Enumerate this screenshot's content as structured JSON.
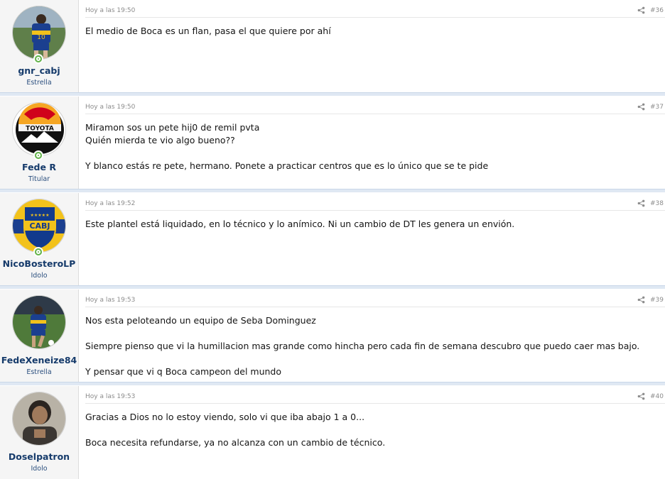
{
  "colors": {
    "username": "#163b6b",
    "usertitle": "#2b4f7e",
    "online": "#63b34a",
    "separator": "#dfe8f3"
  },
  "posts": [
    {
      "username": "gnr_cabj",
      "user_title": "Estrella",
      "avatar": "player-photo-avatar",
      "online": true,
      "date": "Hoy a las 19:50",
      "number": "#36",
      "lines": [
        "El medio de Boca es un flan, pasa el que quiere por ahí"
      ]
    },
    {
      "username": "Fede R",
      "user_title": "Titular",
      "avatar": "toyota-logo-avatar",
      "online": true,
      "date": "Hoy a las 19:50",
      "number": "#37",
      "lines": [
        "Miramon sos un pete hij0 de remil pvta",
        "Quién mierda te vio algo bueno??",
        "",
        "Y blanco estás re pete, hermano. Ponete a practicar centros que es lo único que se te pide"
      ]
    },
    {
      "username": "NicoBosteroLP",
      "user_title": "Idolo",
      "avatar": "cabj-crest-avatar",
      "online": true,
      "date": "Hoy a las 19:52",
      "number": "#38",
      "lines": [
        "Este plantel está liquidado, en lo técnico y lo anímico. Ni un cambio de DT les genera un envión."
      ]
    },
    {
      "username": "FedeXeneize84",
      "user_title": "Estrella",
      "avatar": "player-photo-avatar",
      "online": false,
      "date": "Hoy a las 19:53",
      "number": "#39",
      "lines": [
        "Nos esta peloteando un equipo de Seba Dominguez",
        "",
        "Siempre pienso que vi la humillacion mas grande como hincha pero cada fin de semana descubro que puedo caer mas bajo.",
        "",
        "Y pensar que vi q Boca campeon del mundo"
      ]
    },
    {
      "username": "Doselpatron",
      "user_title": "Idolo",
      "avatar": "portrait-photo-avatar",
      "online": false,
      "date": "Hoy a las 19:53",
      "number": "#40",
      "lines": [
        "Gracias a Dios no lo estoy viendo, solo vi que iba abajo 1 a 0...",
        "",
        "Boca necesita refundarse, ya no alcanza con un cambio de técnico."
      ]
    }
  ]
}
